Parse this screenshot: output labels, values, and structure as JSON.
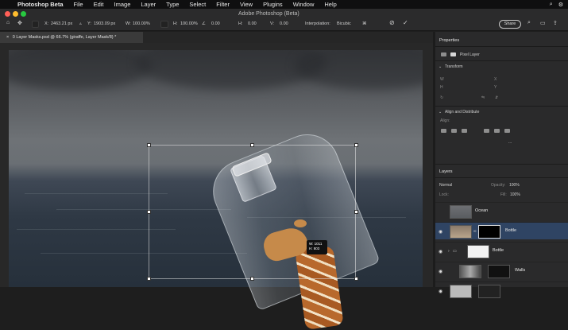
{
  "menu": {
    "apple": "",
    "items": [
      "Photoshop Beta",
      "File",
      "Edit",
      "Image",
      "Layer",
      "Type",
      "Select",
      "Filter",
      "View",
      "Plugins",
      "Window",
      "Help"
    ]
  },
  "window": {
    "title": "Adobe Photoshop (Beta)"
  },
  "options": {
    "x_label": "X:",
    "x_value": "2463.21 px",
    "y_label": "Y:",
    "y_value": "1903.09 px",
    "w_label": "W:",
    "w_value": "100.00%",
    "h_label": "H:",
    "h_value": "100.00%",
    "angle_value": "0.00",
    "h_skew_value": "0.00",
    "v_skew_value": "0.00",
    "interp_label": "Interpolation:",
    "interp_value": "Bicubic",
    "share_label": "Share"
  },
  "document": {
    "tab_label": "0 Layer Masks.psd @ 66.7% (giraffe, Layer Mask/8) *",
    "tooltip_line1": "W: 1011",
    "tooltip_line2": "H: 803"
  },
  "properties": {
    "tab": "Properties",
    "layer_type": "Pixel Layer",
    "transform_title": "Transform",
    "align_title": "Align and Distribute",
    "align_sub": "Align:",
    "more": "..."
  },
  "layers": {
    "tab": "Layers",
    "kind": "Normal",
    "opacity_label": "Opacity:",
    "opacity_value": "100%",
    "lock_label": "Lock:",
    "fill_label": "Fill:",
    "fill_value": "100%",
    "rows": [
      {
        "name": "Ocean",
        "selected": false
      },
      {
        "name": "Bottle",
        "selected": true
      },
      {
        "name": "Bottle",
        "selected": false
      },
      {
        "name": "Walls",
        "selected": false
      }
    ]
  },
  "colors": {
    "accent": "#2f4463",
    "panel": "#2a2a2b",
    "menubar": "#0f0f10"
  },
  "icons": [
    "apple-icon",
    "home-icon",
    "move-tool-icon",
    "cancel-transform-icon",
    "commit-transform-icon",
    "search-icon",
    "gear-icon",
    "eye-icon",
    "close-icon",
    "chain-link-icon"
  ]
}
